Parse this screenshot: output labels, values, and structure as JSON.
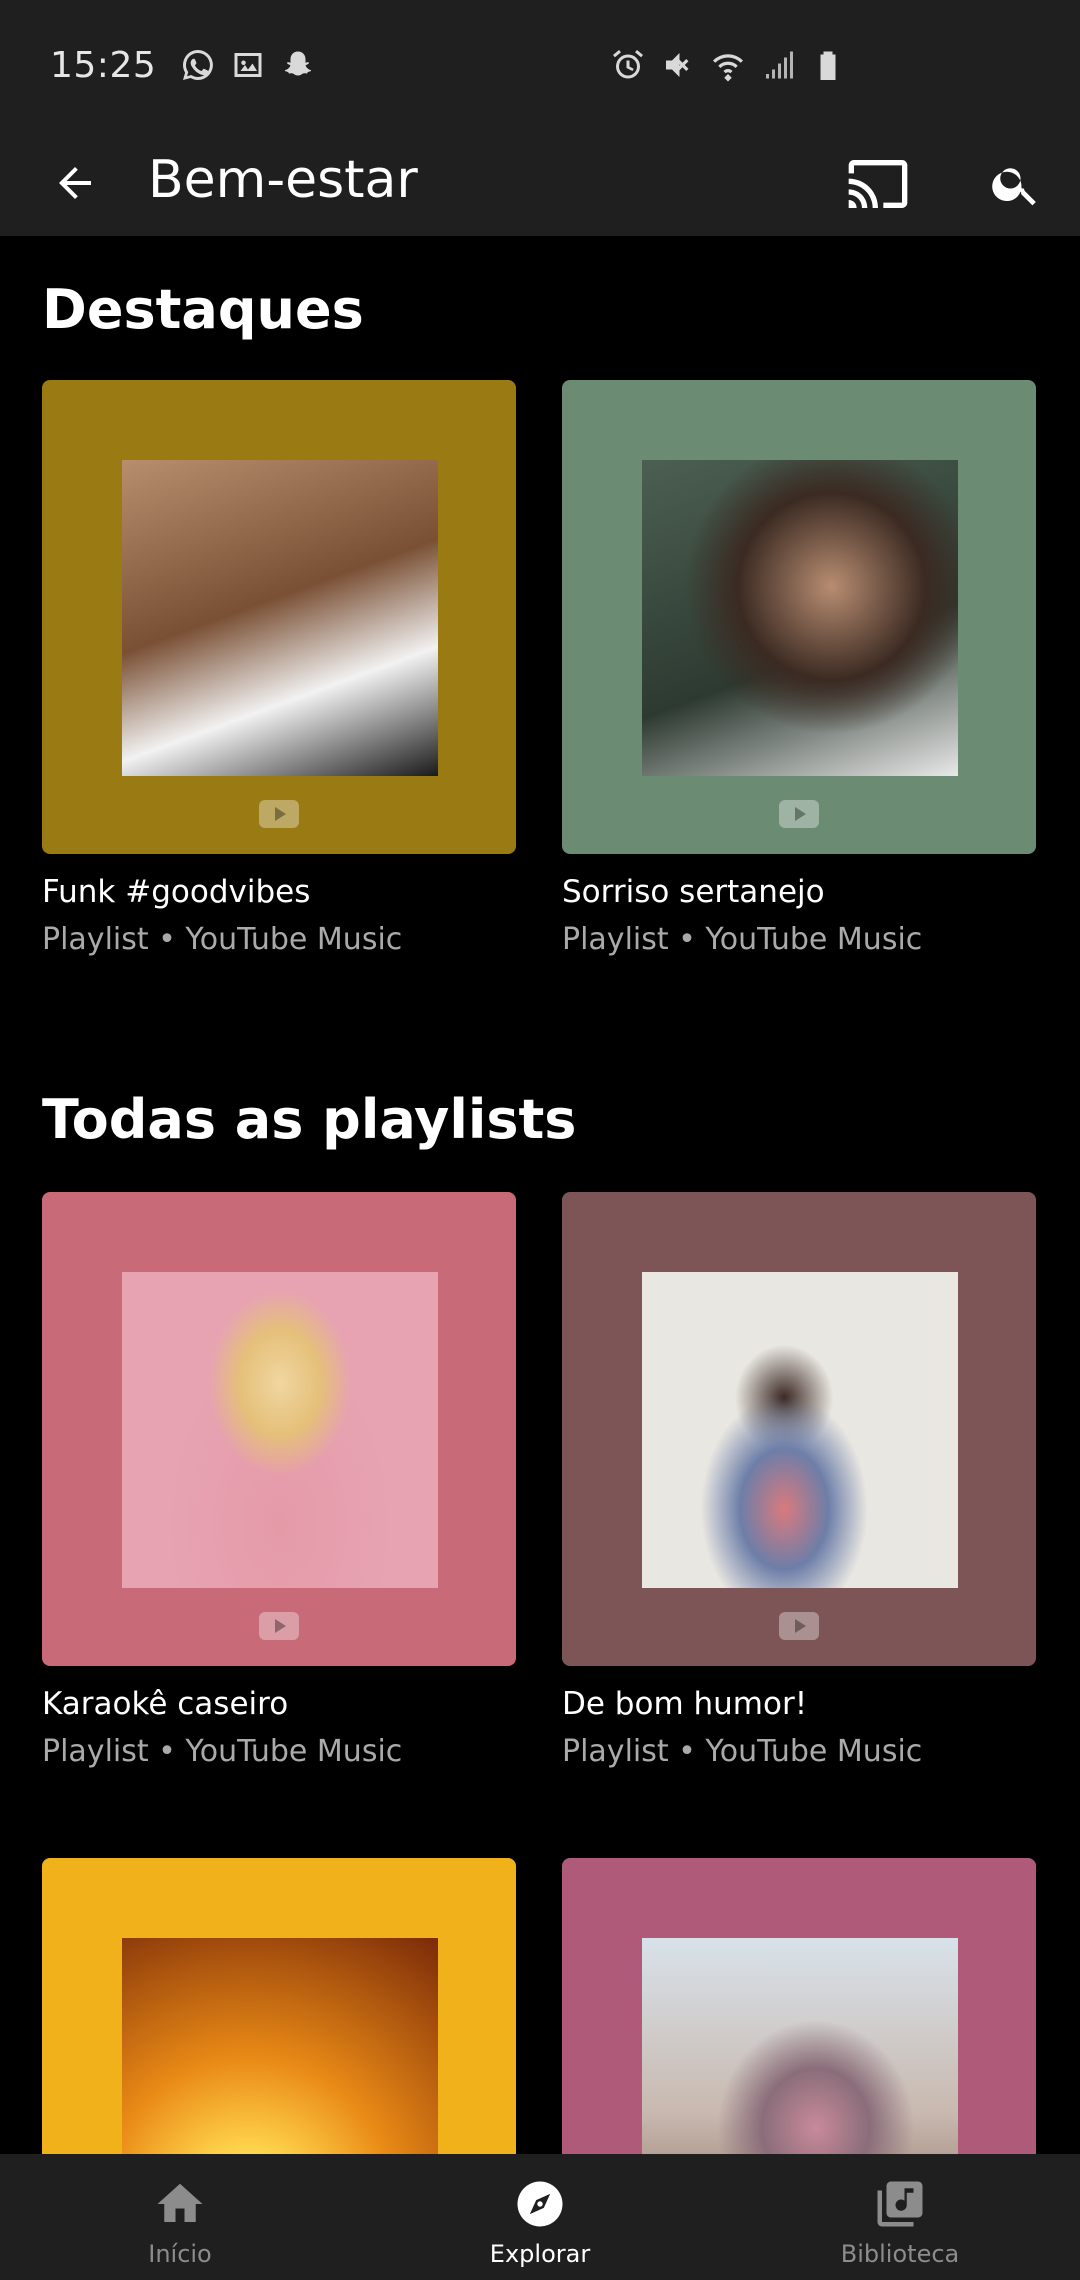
{
  "status_bar": {
    "time": "15:25",
    "left_icons": [
      "whatsapp-icon",
      "image-icon",
      "snapchat-icon"
    ],
    "right_icons": [
      "alarm-icon",
      "mute-icon",
      "wifi-icon",
      "signal-icon",
      "battery-icon"
    ]
  },
  "app_bar": {
    "title": "Bem-estar",
    "back_icon": "arrow-back-icon",
    "cast_icon": "cast-icon",
    "search_icon": "search-icon"
  },
  "sections": [
    {
      "title": "Destaques",
      "cards": [
        {
          "title": "Funk #goodvibes",
          "subtitle": "Playlist • YouTube Music",
          "bg_color": "#9a7a12",
          "inner_color": "#7a5a38"
        },
        {
          "title": "Sorriso sertanejo",
          "subtitle": "Playlist • YouTube Music",
          "bg_color": "#6b8b72",
          "inner_color": "#3f5446"
        }
      ]
    },
    {
      "title": "Todas as playlists",
      "cards": [
        {
          "title": "Karaokê caseiro",
          "subtitle": "Playlist • YouTube Music",
          "bg_color": "#c86a78",
          "inner_color": "#e7a3b2"
        },
        {
          "title": "De bom humor!",
          "subtitle": "Playlist • YouTube Music",
          "bg_color": "#7e5556",
          "inner_color": "#e9e7e2"
        },
        {
          "title": "",
          "subtitle": "",
          "bg_color": "#f0b11b",
          "inner_color": "#e98a16"
        },
        {
          "title": "",
          "subtitle": "",
          "bg_color": "#b05a7a",
          "inner_color": "#c9b9b0"
        }
      ]
    }
  ],
  "bottom_nav": [
    {
      "label": "Início",
      "icon": "home-icon",
      "active": false
    },
    {
      "label": "Explorar",
      "icon": "explore-icon",
      "active": true
    },
    {
      "label": "Biblioteca",
      "icon": "library-icon",
      "active": false
    }
  ]
}
